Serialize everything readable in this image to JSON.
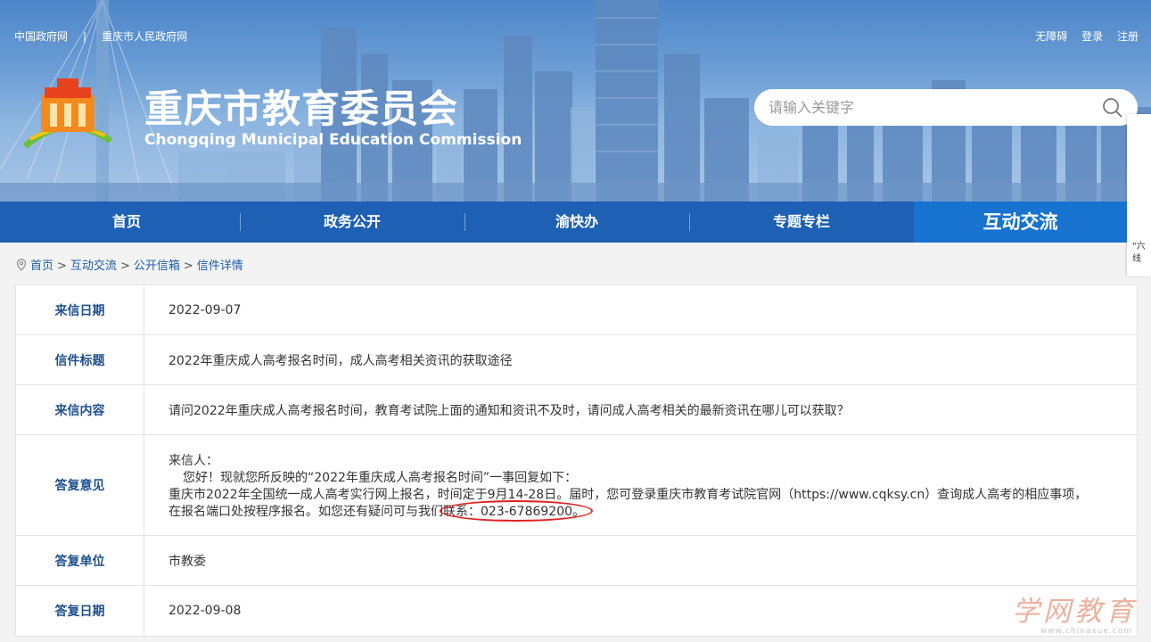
{
  "header": {
    "top_links": [
      "中国政府网",
      "重庆市人民政府网"
    ],
    "user_links": [
      "无障碍",
      "登录",
      "注册"
    ],
    "title": "重庆市教育委员会",
    "subtitle": "Chongqing Municipal Education Commission",
    "search_placeholder": "请输入关键字"
  },
  "side_panel": {
    "text": "\"六\n线"
  },
  "nav": {
    "items": [
      "首页",
      "政务公开",
      "渝快办",
      "专题专栏",
      "互动交流"
    ],
    "active": "互动交流"
  },
  "breadcrumb": [
    "首页",
    "互动交流",
    "公开信箱",
    "信件详情"
  ],
  "letter": {
    "date_label": "来信日期",
    "date": "2022-09-07",
    "subject_label": "信件标题",
    "subject": "2022年重庆成人高考报名时间，成人高考相关资讯的获取途径",
    "content_label": "来信内容",
    "content": "请问2022年重庆成人高考报名时间，教育考试院上面的通知和资讯不及时，请问成人高考相关的最新资讯在哪儿可以获取？",
    "reply_label": "答复意见",
    "reply_lines": [
      "来信人：",
      "您好！现就您所反映的“2022年重庆成人高考报名时间”一事回复如下：",
      "重庆市2022年全国统一成人高考实行网上报名，时间定于9月14-28日。届时，您可登录重庆市教育考试院官网（https://www.cqksy.cn）查询成人高考的相应事项，",
      "在报名端口处按程序报名。如您还有疑问可与我们联系：023-67869200。"
    ],
    "unit_label": "答复单位",
    "unit": "市教委",
    "reply_date_label": "答复日期",
    "reply_date": "2022-09-08"
  },
  "watermark": {
    "text": "学网教育",
    "url": "www.chinaxue.com"
  },
  "colors": {
    "nav_bg": "#1e60b3",
    "nav_active": "#1872d0",
    "label_text": "#1e4f8e",
    "highlight_oval": "#e02020"
  }
}
